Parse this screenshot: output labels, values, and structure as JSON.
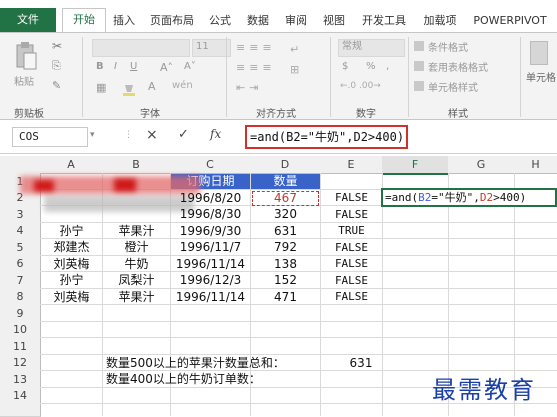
{
  "tabs": {
    "file": "文件",
    "home": "开始",
    "insert": "插入",
    "layout": "页面布局",
    "formulas": "公式",
    "data": "数据",
    "review": "审阅",
    "view": "视图",
    "dev": "开发工具",
    "addins": "加载项",
    "powerpivot": "POWERPIVOT"
  },
  "ribbon": {
    "paste": "粘贴",
    "clipboard": "剪贴板",
    "font_group": "字体",
    "align_group": "对齐方式",
    "number_group": "数字",
    "styles_group": "样式",
    "font_size": "11",
    "number_format": "常规",
    "bold": "B",
    "italic": "I",
    "underline": "U",
    "percent": "%",
    "comma": ",",
    "dollar": "$",
    "cond_format": "条件格式",
    "table_format": "套用表格格式",
    "cell_styles": "单元格样式",
    "cells": "单元格"
  },
  "formula_bar": {
    "name_box": "COS",
    "cancel": "×",
    "confirm": "✓",
    "fx": "fx",
    "formula": "=and(B2=\"牛奶\",D2>400)"
  },
  "columns": [
    "A",
    "B",
    "C",
    "D",
    "E",
    "F",
    "G",
    "H"
  ],
  "rows": [
    {
      "n": "1",
      "c": "订购日期",
      "d": "数量"
    },
    {
      "n": "2",
      "c": "1996/8/20",
      "d": "467",
      "e": "FALSE"
    },
    {
      "n": "3",
      "c": "1996/8/30",
      "d": "320",
      "e": "FALSE"
    },
    {
      "n": "4",
      "a": "孙宁",
      "b": "苹果汁",
      "c": "1996/9/30",
      "d": "631",
      "e": "TRUE"
    },
    {
      "n": "5",
      "a": "郑建杰",
      "b": "橙汁",
      "c": "1996/11/7",
      "d": "792",
      "e": "FALSE"
    },
    {
      "n": "6",
      "a": "刘英梅",
      "b": "牛奶",
      "c": "1996/11/14",
      "d": "138",
      "e": "FALSE"
    },
    {
      "n": "7",
      "a": "孙宁",
      "b": "凤梨汁",
      "c": "1996/12/3",
      "d": "152",
      "e": "FALSE"
    },
    {
      "n": "8",
      "a": "刘英梅",
      "b": "苹果汁",
      "c": "1996/11/14",
      "d": "471",
      "e": "FALSE"
    },
    {
      "n": "9"
    },
    {
      "n": "10"
    },
    {
      "n": "11"
    },
    {
      "n": "12"
    },
    {
      "n": "13"
    },
    {
      "n": "14"
    }
  ],
  "edit_cell": {
    "prefix": "=and(",
    "ref1": "B2",
    "mid": "=\"牛奶\",",
    "ref2": "D2",
    "suffix": ">400)"
  },
  "summary": {
    "label1": "数量500以上的苹果汁数量总和：",
    "value1": "631",
    "label2": "数量400以上的牛奶订单数："
  },
  "watermark": "最需教育",
  "colors": {
    "excel_green": "#217346",
    "ref_blue": "#3d5ee1",
    "ref_red": "#c0392b",
    "header_blue": "#3a63c9",
    "highlight_red": "#d0312d"
  }
}
